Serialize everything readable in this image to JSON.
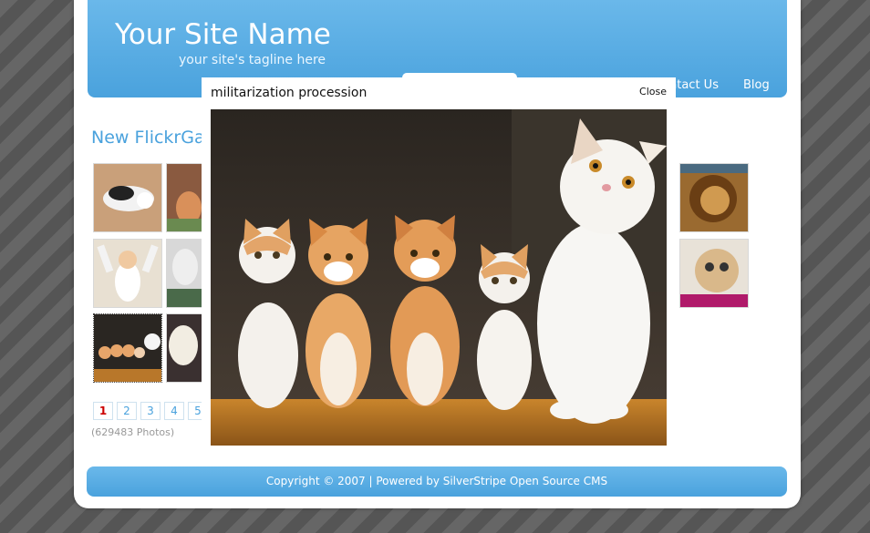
{
  "header": {
    "site_name": "Your Site Name",
    "tagline": "your site's tagline here"
  },
  "nav": {
    "items": [
      {
        "label": "ntact Us"
      },
      {
        "label": "Blog"
      }
    ]
  },
  "gallery": {
    "title": "New FlickrGal",
    "photo_count": "(629483 Photos)",
    "pages": [
      "1",
      "2",
      "3",
      "4",
      "5"
    ],
    "current_page": "1"
  },
  "lightbox": {
    "caption": "militarization procession",
    "close_label": "Close"
  },
  "footer": {
    "text": "Copyright © 2007 | Powered by SilverStripe Open Source CMS"
  },
  "colors": {
    "header_blue": "#4aa2dd",
    "link_blue": "#4aa2dd",
    "current_page_red": "#cc0000"
  }
}
